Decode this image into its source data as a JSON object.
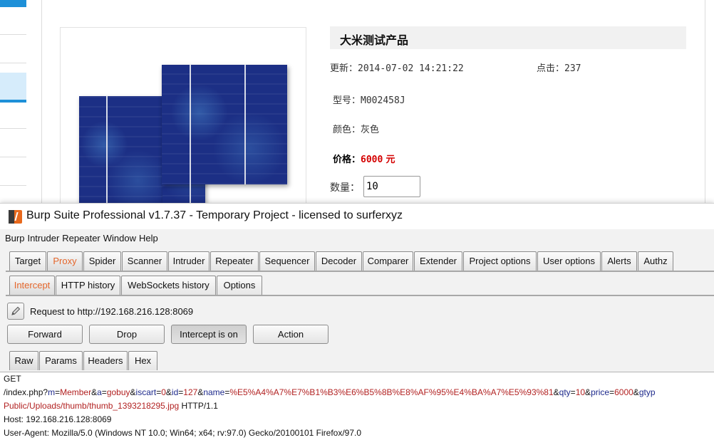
{
  "webpage": {
    "product_title": "大米测试产品",
    "update_label": "更新：",
    "update_value": "2014-07-02 14:21:22",
    "clicks_label": "点击：",
    "clicks_value": "237",
    "model_label": "型号：",
    "model_value": "M002458J",
    "color_label": "颜色：",
    "color_value": "灰色",
    "price_label": "价格：",
    "price_value": "6000",
    "price_unit": "元",
    "quantity_label": "数量：",
    "quantity_value": "10"
  },
  "burp": {
    "window_title": "Burp Suite Professional v1.7.37 - Temporary Project - licensed to surferxyz",
    "menu": [
      "Burp",
      "Intruder",
      "Repeater",
      "Window",
      "Help"
    ],
    "tabs": [
      "Target",
      "Proxy",
      "Spider",
      "Scanner",
      "Intruder",
      "Repeater",
      "Sequencer",
      "Decoder",
      "Comparer",
      "Extender",
      "Project options",
      "User options",
      "Alerts",
      "Authz"
    ],
    "active_tab": "Proxy",
    "subtabs": [
      "Intercept",
      "HTTP history",
      "WebSockets history",
      "Options"
    ],
    "active_subtab": "Intercept",
    "request_label": "Request to http://192.168.216.128:8069",
    "buttons": {
      "forward": "Forward",
      "drop": "Drop",
      "intercept": "Intercept is on",
      "action": "Action"
    },
    "editor_tabs": [
      "Raw",
      "Params",
      "Headers",
      "Hex"
    ],
    "active_editor_tab": "Raw",
    "request": {
      "method": "GET",
      "path": "/index.php?",
      "params": [
        {
          "key": "m",
          "value": "Member"
        },
        {
          "key": "a",
          "value": "gobuy"
        },
        {
          "key": "iscart",
          "value": "0"
        },
        {
          "key": "id",
          "value": "127"
        },
        {
          "key": "name",
          "value": "%E5%A4%A7%E7%B1%B3%E6%B5%8B%E8%AF%95%E4%BA%A7%E5%93%81"
        },
        {
          "key": "qty",
          "value": "10"
        },
        {
          "key": "price",
          "value": "6000"
        },
        {
          "key": "gtyp",
          "value": ""
        }
      ],
      "line3_value": "Public/Uploads/thumb/thumb_1393218295.jpg",
      "line3_suffix": " HTTP/1.1",
      "host": "Host: 192.168.216.128:8069",
      "user_agent": "User-Agent: Mozilla/5.0 (Windows NT 10.0; Win64; x64; rv:97.0) Gecko/20100101 Firefox/97.0"
    }
  },
  "colors": {
    "accent_orange": "#e4662b",
    "price_red": "#d40000",
    "param_key": "#1e2a8c",
    "param_value": "#b22222"
  }
}
